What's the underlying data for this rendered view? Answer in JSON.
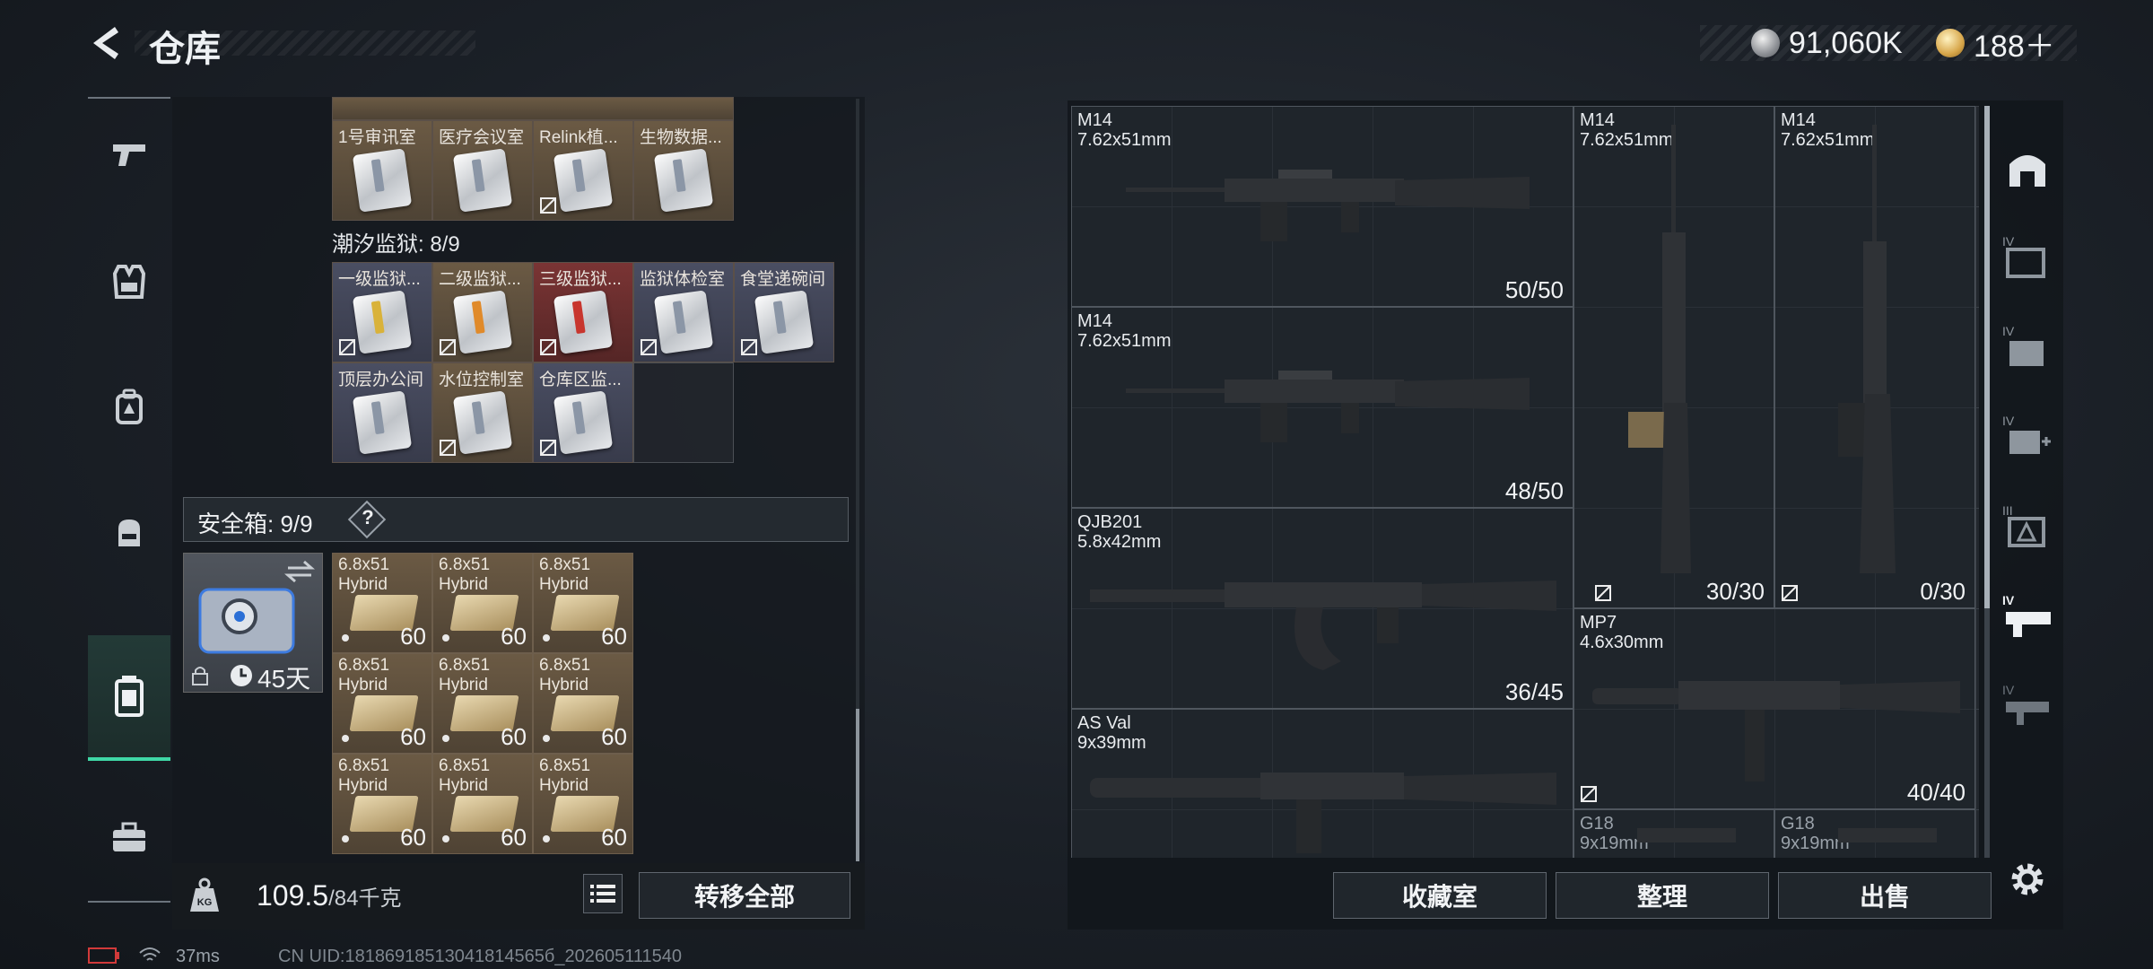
{
  "header": {
    "title": "仓库",
    "currencies": [
      {
        "icon": "silver-coin-icon",
        "value": "91,060K"
      },
      {
        "icon": "gold-coin-icon",
        "value": "188＋"
      }
    ]
  },
  "nav": {
    "items": [
      {
        "name": "weapons",
        "icon": "pistol-icon"
      },
      {
        "name": "armor",
        "icon": "vest-icon"
      },
      {
        "name": "backpack",
        "icon": "backpack-icon"
      },
      {
        "name": "bag",
        "icon": "bag-icon"
      },
      {
        "name": "warehouse",
        "icon": "container-icon",
        "active": true
      },
      {
        "name": "toolbox",
        "icon": "toolbox-icon"
      }
    ]
  },
  "keycards_row0": [
    {
      "label": "1号审讯室"
    },
    {
      "label": "医疗会议室"
    },
    {
      "label": "Relink植..."
    },
    {
      "label": "生物数据..."
    }
  ],
  "tidal_prison": {
    "title": "潮汐监狱: 8/9",
    "cells": [
      {
        "label": "一级监狱...",
        "color": "blue",
        "card": "yellow"
      },
      {
        "label": "二级监狱...",
        "color": "tan",
        "card": "orange"
      },
      {
        "label": "三级监狱...",
        "color": "red",
        "card": "red"
      },
      {
        "label": "监狱体检室",
        "color": "blue",
        "card": "grey"
      },
      {
        "label": "食堂递碗间",
        "color": "blue",
        "card": "grey"
      },
      {
        "label": "顶层办公间",
        "color": "blue",
        "card": "grey"
      },
      {
        "label": "水位控制室",
        "color": "tan",
        "card": "grey"
      },
      {
        "label": "仓库区监...",
        "color": "blue",
        "card": "grey"
      }
    ]
  },
  "safebox": {
    "label": "安全箱: 9/9",
    "help": "?",
    "timer": "45天",
    "ammo": [
      {
        "name1": "6.8x51",
        "name2": "Hybrid",
        "count": "60"
      },
      {
        "name1": "6.8x51",
        "name2": "Hybrid",
        "count": "60"
      },
      {
        "name1": "6.8x51",
        "name2": "Hybrid",
        "count": "60"
      },
      {
        "name1": "6.8x51",
        "name2": "Hybrid",
        "count": "60"
      },
      {
        "name1": "6.8x51",
        "name2": "Hybrid",
        "count": "60"
      },
      {
        "name1": "6.8x51",
        "name2": "Hybrid",
        "count": "60"
      },
      {
        "name1": "6.8x51",
        "name2": "Hybrid",
        "count": "60"
      },
      {
        "name1": "6.8x51",
        "name2": "Hybrid",
        "count": "60"
      },
      {
        "name1": "6.8x51",
        "name2": "Hybrid",
        "count": "60"
      }
    ]
  },
  "weight": {
    "current": "109.5",
    "capacity": "/84千克",
    "transfer_all": "转移全部"
  },
  "weapons": [
    {
      "name": "M14",
      "caliber": "7.62x51mm",
      "ammo": "50/50"
    },
    {
      "name": "M14",
      "caliber": "7.62x51mm",
      "ammo": "48/50"
    },
    {
      "name": "QJB201",
      "caliber": "5.8x42mm",
      "ammo": "36/45"
    },
    {
      "name": "AS Val",
      "caliber": "9x39mm",
      "ammo": ""
    },
    {
      "name": "M14",
      "caliber": "7.62x51mm",
      "ammo": "30/30"
    },
    {
      "name": "M14",
      "caliber": "7.62x51mm",
      "ammo": "0/30"
    },
    {
      "name": "MP7",
      "caliber": "4.6x30mm",
      "ammo": "40/40"
    },
    {
      "name": "G18",
      "caliber": "9x19mm",
      "ammo": ""
    },
    {
      "name": "G18",
      "caliber": "9x19mm",
      "ammo": ""
    }
  ],
  "actions": {
    "collection": "收藏室",
    "organize": "整理",
    "sell": "出售"
  },
  "side_rail": [
    {
      "icon": "vault-icon"
    },
    {
      "icon": "tier4-armor-icon",
      "label": "IV"
    },
    {
      "icon": "tier4-chest-icon",
      "label": "IV"
    },
    {
      "icon": "tier4-medkit-icon",
      "label": "IV"
    },
    {
      "icon": "tier3-helmet-icon",
      "label": "III"
    },
    {
      "icon": "tier4-rifle-icon",
      "label": "IV",
      "active": true
    },
    {
      "icon": "tier4-smg-icon",
      "label": "IV"
    },
    {
      "icon": "settings-gear-icon"
    }
  ],
  "status": {
    "ping": "37ms",
    "uid": "CN UID:18186918513041814565б_202605111540"
  }
}
